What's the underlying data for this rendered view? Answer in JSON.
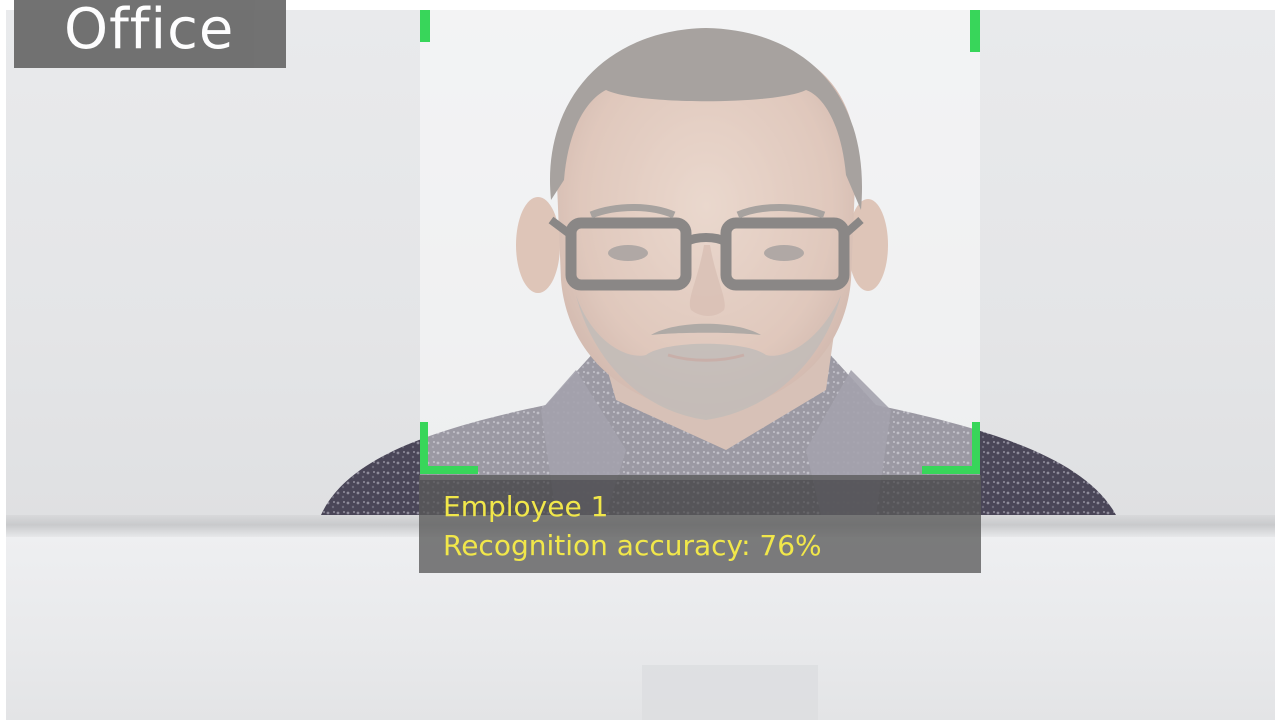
{
  "location": {
    "label": "Office"
  },
  "detection": {
    "employee_name": "Employee 1",
    "accuracy_label": "Recognition accuracy:",
    "accuracy_value": "76%",
    "accuracy_fraction": 0.76,
    "box_color": "#38d65a",
    "text_color": "#f1e74a"
  },
  "colors": {
    "label_background": "#6b6b6b",
    "info_background": "#5a5a5a"
  }
}
